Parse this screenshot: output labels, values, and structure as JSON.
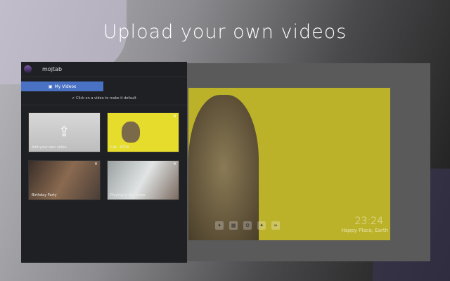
{
  "headline": "Upload your own videos",
  "panel": {
    "brand": "mojtab",
    "tab_label": "My Videos",
    "hint": "Click on a video to make it default",
    "videos": [
      {
        "label": "Add your own video"
      },
      {
        "label": "Cat - 6709"
      },
      {
        "label": "Birthday Party"
      },
      {
        "label": "Playing in the Snow"
      }
    ]
  },
  "preview": {
    "time": "23:24",
    "location": "Happy Place, Earth"
  },
  "colors": {
    "accent": "#4a72c4",
    "panel": "#1f2023"
  }
}
